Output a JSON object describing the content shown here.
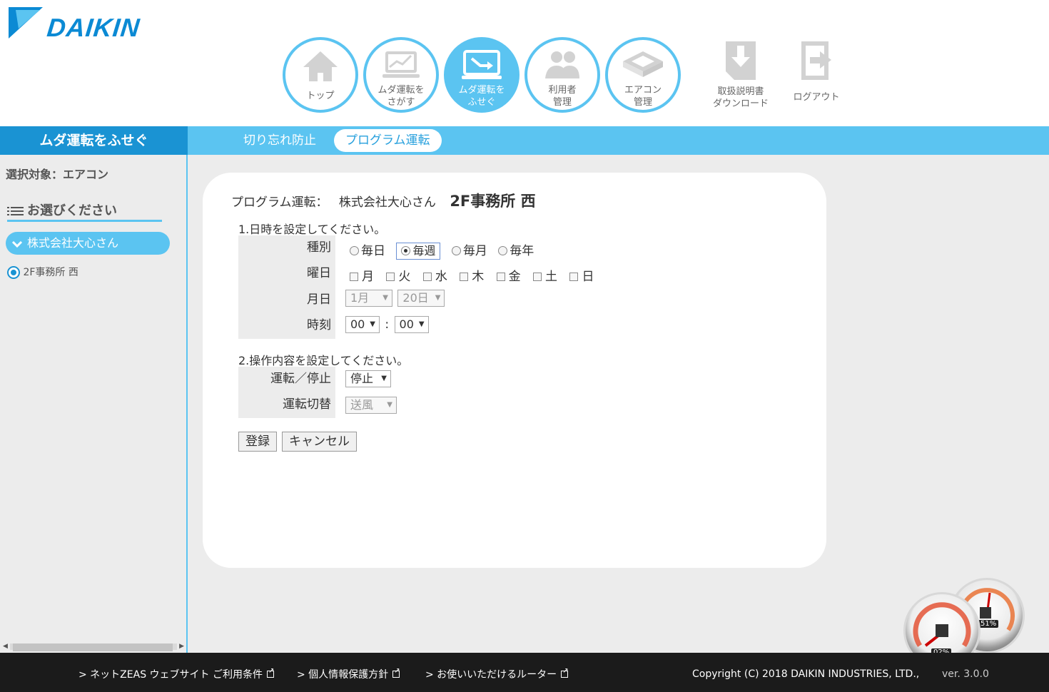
{
  "brand": {
    "name": "DAIKIN",
    "color": "#0b8ad4"
  },
  "nav": [
    {
      "label": "トップ",
      "icon": "home-icon",
      "active": false
    },
    {
      "label": "ムダ運転を\nさがす",
      "icon": "chart-icon",
      "active": false
    },
    {
      "label": "ムダ運転を\nふせぐ",
      "icon": "monitor-icon",
      "active": true
    },
    {
      "label": "利用者\n管理",
      "icon": "users-icon",
      "active": false
    },
    {
      "label": "エアコン\n管理",
      "icon": "aircon-icon",
      "active": false
    }
  ],
  "nav_extra": [
    {
      "label": "取扱説明書\nダウンロード",
      "icon": "download-icon"
    },
    {
      "label": "ログアウト",
      "icon": "logout-icon"
    }
  ],
  "section_title": "ムダ運転をふせぐ",
  "tabs": [
    {
      "label": "切り忘れ防止",
      "active": false
    },
    {
      "label": "プログラム運転",
      "active": true
    }
  ],
  "sidebar": {
    "target": "選択対象：エアコン",
    "choose": "お選びください",
    "group": "株式会社大心さん",
    "site": "2F事務所 西"
  },
  "form": {
    "title_prefix": "プログラム運転：",
    "company": "株式会社大心さん",
    "site": "2F事務所 西",
    "step1": "1.日時を設定してください。",
    "step2": "2.操作内容を設定してください。",
    "labels": {
      "type": "種別",
      "weekday": "曜日",
      "monthday": "月日",
      "time": "時刻",
      "onoff": "運転／停止",
      "mode": "運転切替"
    },
    "type_options": [
      "毎日",
      "毎週",
      "毎月",
      "毎年"
    ],
    "type_selected": "毎週",
    "weekdays": [
      "月",
      "火",
      "水",
      "木",
      "金",
      "土",
      "日"
    ],
    "month": "1月",
    "day": "20日",
    "hour": "00",
    "minute": "00",
    "time_sep": ":",
    "onoff_value": "停止",
    "mode_value": "送風",
    "register": "登録",
    "cancel": "キャンセル"
  },
  "footer": {
    "links": [
      "> ネットZEAS ウェブサイト ご利用条件",
      "> 個人情報保護方針",
      "> お使いいただけるルーター"
    ],
    "copyright": "Copyright (C) 2018 DAIKIN INDUSTRIES, LTD.,",
    "version": "ver. 3.0.0"
  },
  "gauges": {
    "cpu": "02%",
    "memory": "51%"
  },
  "colors": {
    "accent": "#5bc4f1",
    "accent_dark": "#1a93d3",
    "footer": "#1b1b1b"
  }
}
